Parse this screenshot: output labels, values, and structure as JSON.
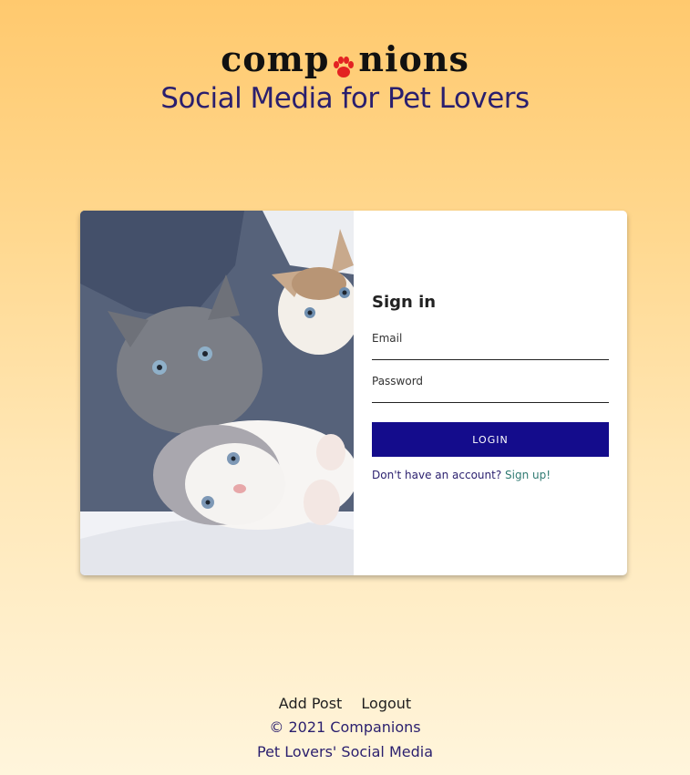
{
  "header": {
    "logo_left": "comp",
    "logo_right": "nions",
    "tagline": "Social Media for Pet Lovers"
  },
  "signin": {
    "title": "Sign in",
    "email_label": "Email",
    "password_label": "Password",
    "login_label": "LOGIN",
    "no_account_text": "Don't have an account?",
    "signup_link": "Sign up!"
  },
  "footer": {
    "nav": [
      "Add Post",
      "Logout"
    ],
    "copyright": "© 2021 Companions",
    "subtitle": "Pet Lovers' Social Media"
  },
  "colors": {
    "accent": "#140c8c",
    "paw": "#e32222",
    "tagline": "#2a1f6e",
    "link": "#2f7a72"
  },
  "icons": {
    "logo_paw": "paw-icon"
  }
}
